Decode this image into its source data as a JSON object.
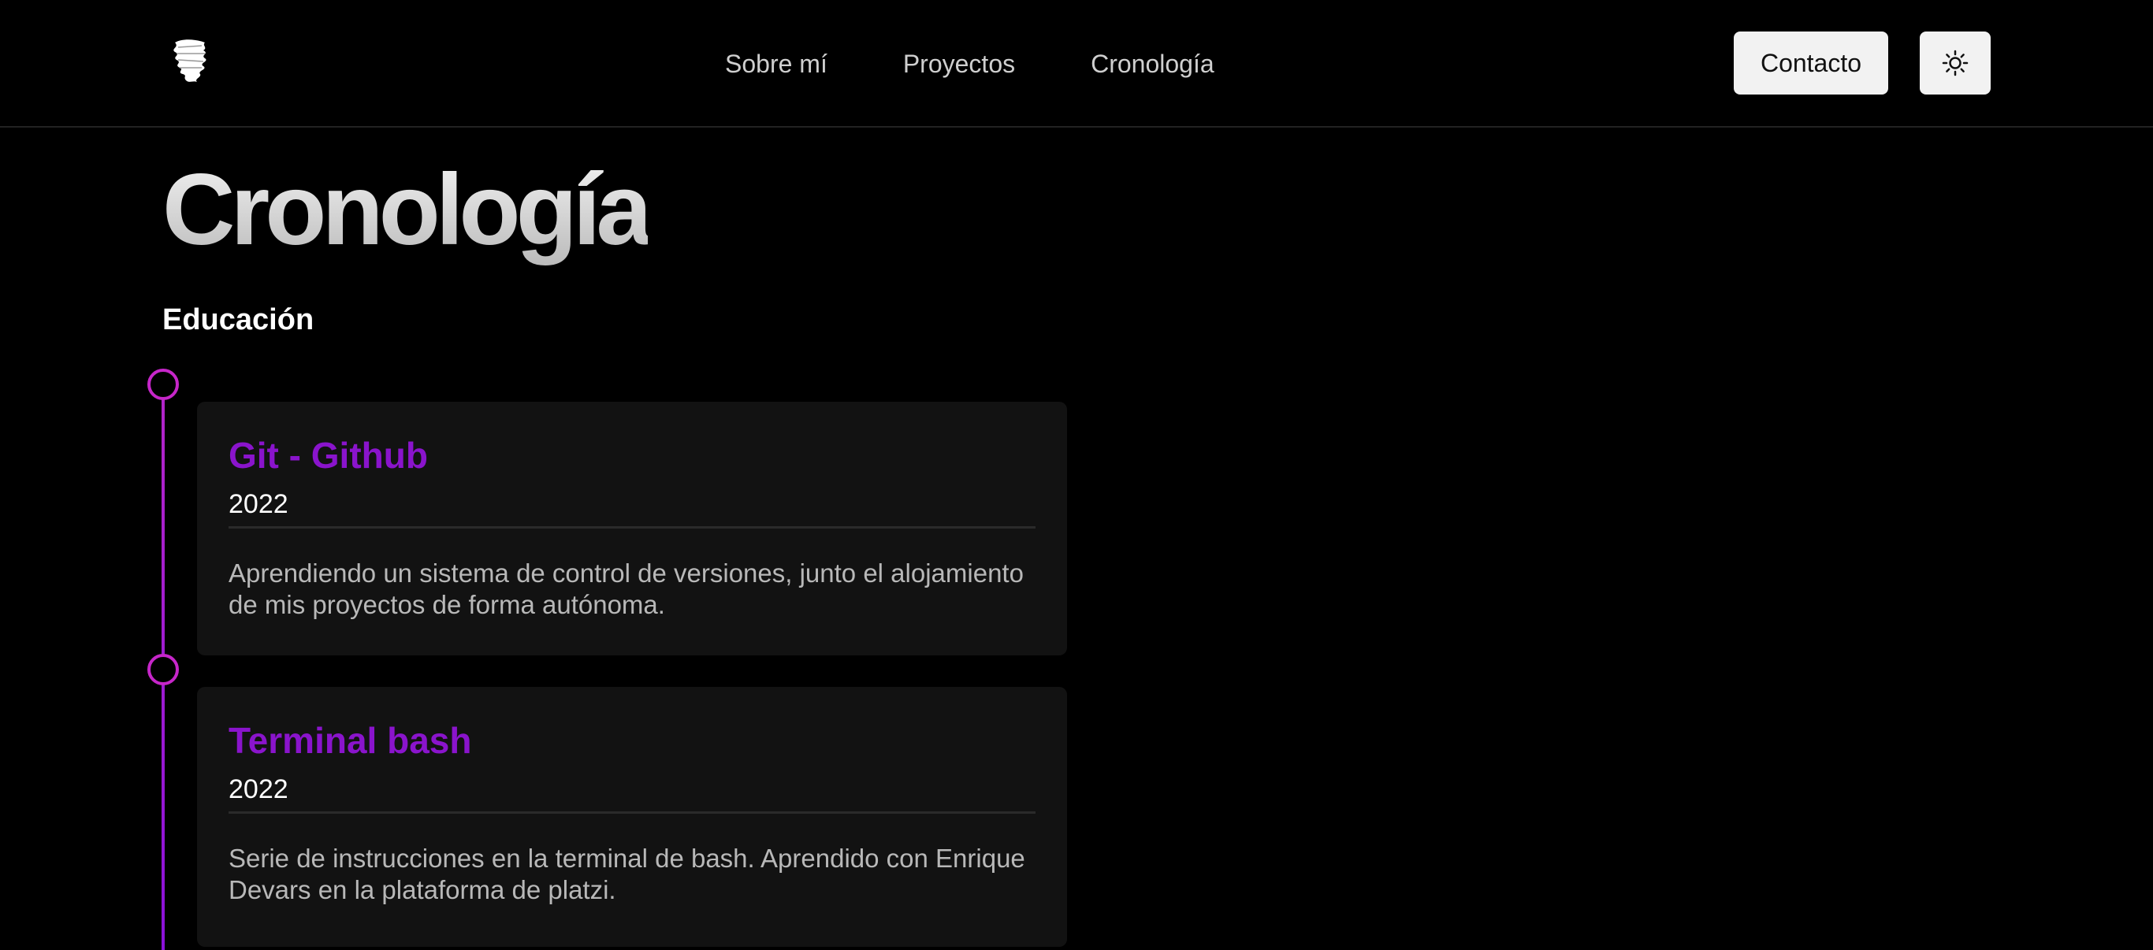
{
  "header": {
    "logo_icon": "brush-stroke-logo-icon",
    "nav": [
      {
        "label": "Sobre mí"
      },
      {
        "label": "Proyectos"
      },
      {
        "label": "Cronología"
      }
    ],
    "contact_label": "Contacto",
    "theme_toggle_icon": "sun-icon"
  },
  "main": {
    "title": "Cronología",
    "section_title": "Educación",
    "timeline": [
      {
        "title": "Git - Github",
        "date": "2022",
        "description": "Aprendiendo un sistema de control de versiones, junto el alojamiento de mis proyectos de forma autónoma."
      },
      {
        "title": "Terminal bash",
        "date": "2022",
        "description": "Serie de instrucciones en la terminal de bash. Aprendido con Enrique Devars en la plataforma de platzi."
      }
    ]
  },
  "colors": {
    "background": "#000000",
    "card": "#121212",
    "accent_title": "#8a14cc",
    "timeline_dot": "#c626c9"
  }
}
